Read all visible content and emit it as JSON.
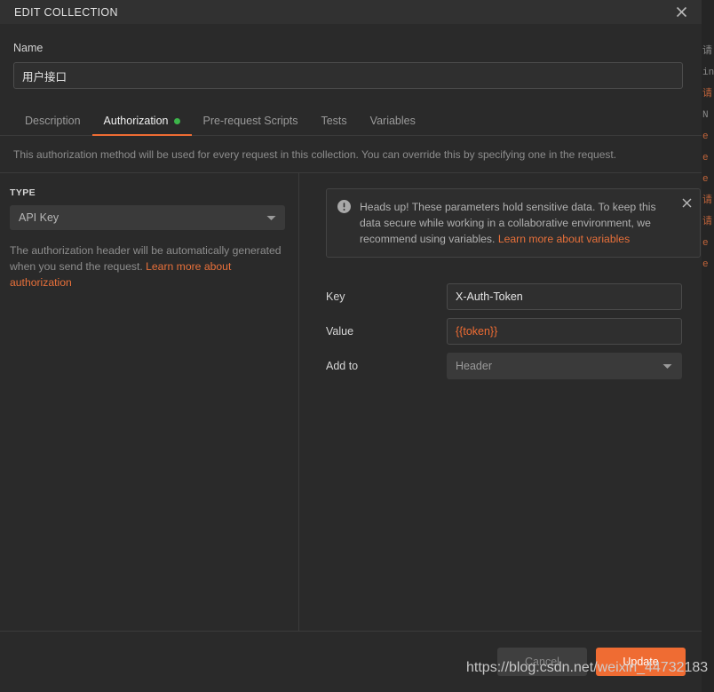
{
  "window": {
    "title": "EDIT COLLECTION",
    "close_icon": "close-icon"
  },
  "name_field": {
    "label": "Name",
    "value": "用户接口",
    "placeholder": ""
  },
  "tabs": [
    {
      "label": "Description",
      "active": false,
      "dot": false
    },
    {
      "label": "Authorization",
      "active": true,
      "dot": true
    },
    {
      "label": "Pre-request Scripts",
      "active": false,
      "dot": false
    },
    {
      "label": "Tests",
      "active": false,
      "dot": false
    },
    {
      "label": "Variables",
      "active": false,
      "dot": false
    }
  ],
  "info_strip": {
    "text": "This authorization method will be used for every request in this collection. You can override this by specifying one in the request."
  },
  "auth_left": {
    "type_label": "TYPE",
    "type_value": "API Key",
    "caret_icon": "chevron-down-icon",
    "helper_text_1": "The authorization header will be automatically generated when you send the request. ",
    "helper_link": "Learn more about authorization"
  },
  "callout": {
    "icon": "alert-circle-icon",
    "text": "Heads up! These parameters hold sensitive data. To keep this data secure while working in a collaborative environment, we recommend using variables. ",
    "link": "Learn more about variables",
    "close_icon": "close-icon"
  },
  "form": {
    "key": {
      "label": "Key",
      "value": "X-Auth-Token",
      "placeholder": "Key"
    },
    "value": {
      "label": "Value",
      "value": "{{token}}",
      "placeholder": "Value"
    },
    "add_to": {
      "label": "Add to",
      "value": "Header",
      "caret_icon": "chevron-down-icon"
    }
  },
  "footer": {
    "cancel_label": "Cancel",
    "update_label": "Update"
  },
  "watermark": {
    "text": "https://blog.csdn.net/weixin_44732183"
  },
  "background_sliver": {
    "lines": [
      "请",
      "in",
      "请",
      "N",
      "e",
      "e",
      "e",
      "请",
      "请",
      "e",
      "e"
    ]
  },
  "colors": {
    "accent": "#ef6c33",
    "status_dot": "#3cb54a",
    "window_bg": "#2a2a2a",
    "header_bg": "#313131",
    "input_bg": "#2f2f2f",
    "select_bg": "#3a3a3a",
    "border": "#3b3b3b",
    "text_primary": "#e2e2e2",
    "text_muted": "#8d8d8d"
  }
}
